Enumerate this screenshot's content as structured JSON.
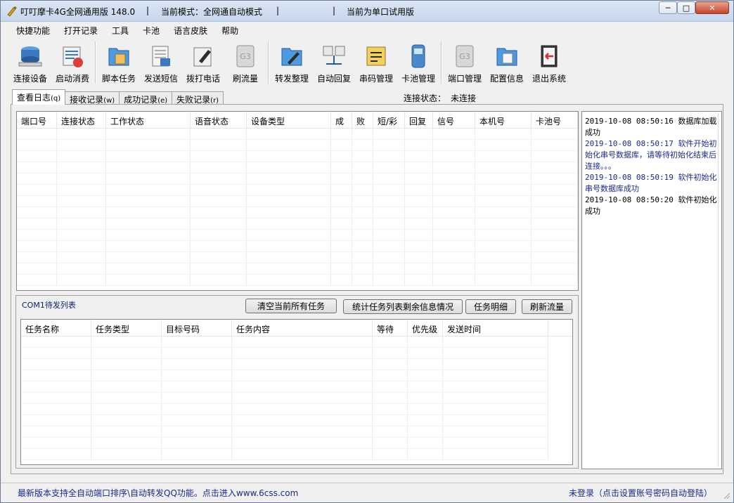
{
  "window": {
    "title_app": "叮叮摩卡4G全网通用版 148.0",
    "title_sep": "|",
    "title_mode": "当前模式：全网通自动模式",
    "title_sep2": "|",
    "title_sep3": "|",
    "title_trial": "当前为单口试用版",
    "minimize": "─",
    "maximize": "□",
    "close": "✕"
  },
  "menu": [
    "快捷功能",
    "打开记录",
    "工具",
    "卡池",
    "语言皮肤",
    "帮助"
  ],
  "toolbar": {
    "items": [
      {
        "label": "连接设备",
        "icon": "device-connect-icon"
      },
      {
        "label": "启动消费",
        "icon": "start-consume-icon"
      },
      {
        "label": "脚本任务",
        "icon": "script-task-icon"
      },
      {
        "label": "发送短信",
        "icon": "send-sms-icon"
      },
      {
        "label": "拨打电话",
        "icon": "dial-phone-icon"
      },
      {
        "label": "刷流量",
        "icon": "g3-traffic-icon"
      },
      {
        "label": "转发整理",
        "icon": "forward-icon"
      },
      {
        "label": "自动回复",
        "icon": "auto-reply-icon"
      },
      {
        "label": "串码管理",
        "icon": "serial-manage-icon"
      },
      {
        "label": "卡池管理",
        "icon": "card-pool-icon"
      },
      {
        "label": "端口管理",
        "icon": "g3-port-icon"
      },
      {
        "label": "配置信息",
        "icon": "config-icon"
      },
      {
        "label": "退出系统",
        "icon": "exit-icon"
      }
    ]
  },
  "tabs": [
    {
      "label": "查看日志",
      "shortcut": "(q)",
      "active": true
    },
    {
      "label": "接收记录",
      "shortcut": "(w)",
      "active": false
    },
    {
      "label": "成功记录",
      "shortcut": "(e)",
      "active": false
    },
    {
      "label": "失败记录",
      "shortcut": "(r)",
      "active": false
    }
  ],
  "connection": {
    "label": "连接状态：",
    "value": "未连接"
  },
  "port_table": {
    "columns": [
      "端口号",
      "连接状态",
      "工作状态",
      "语音状态",
      "设备类型",
      "成",
      "败",
      "短/彩",
      "回复",
      "信号",
      "本机号",
      "卡池号"
    ]
  },
  "task_queue": {
    "title": "COM1待发列表",
    "buttons": [
      "清空当前所有任务",
      "统计任务列表剩余信息情况",
      "任务明细",
      "刷新流量"
    ],
    "columns": [
      "任务名称",
      "任务类型",
      "目标号码",
      "任务内容",
      "等待",
      "优先级",
      "发送时间"
    ]
  },
  "log": [
    {
      "text": "2019-10-08 08:50:16  数据库加载成功",
      "color": "dark"
    },
    {
      "text": "2019-10-08 08:50:17  软件开始初始化串号数据库，请等待初始化结束后连接。。。",
      "color": "blue"
    },
    {
      "text": "2019-10-08 08:50:19  软件初始化串号数据库成功",
      "color": "blue"
    },
    {
      "text": "2019-10-08 08:50:20  软件初始化成功",
      "color": "dark"
    }
  ],
  "status": {
    "left": "最新版本支持全自动端口排序\\自动转发QQ功能。点击进入www.6css.com",
    "right": "未登录（点击设置账号密码自动登陆）"
  },
  "colors": {
    "link_blue": "#1b2a8c",
    "title_bg": "#c6d6ec"
  }
}
